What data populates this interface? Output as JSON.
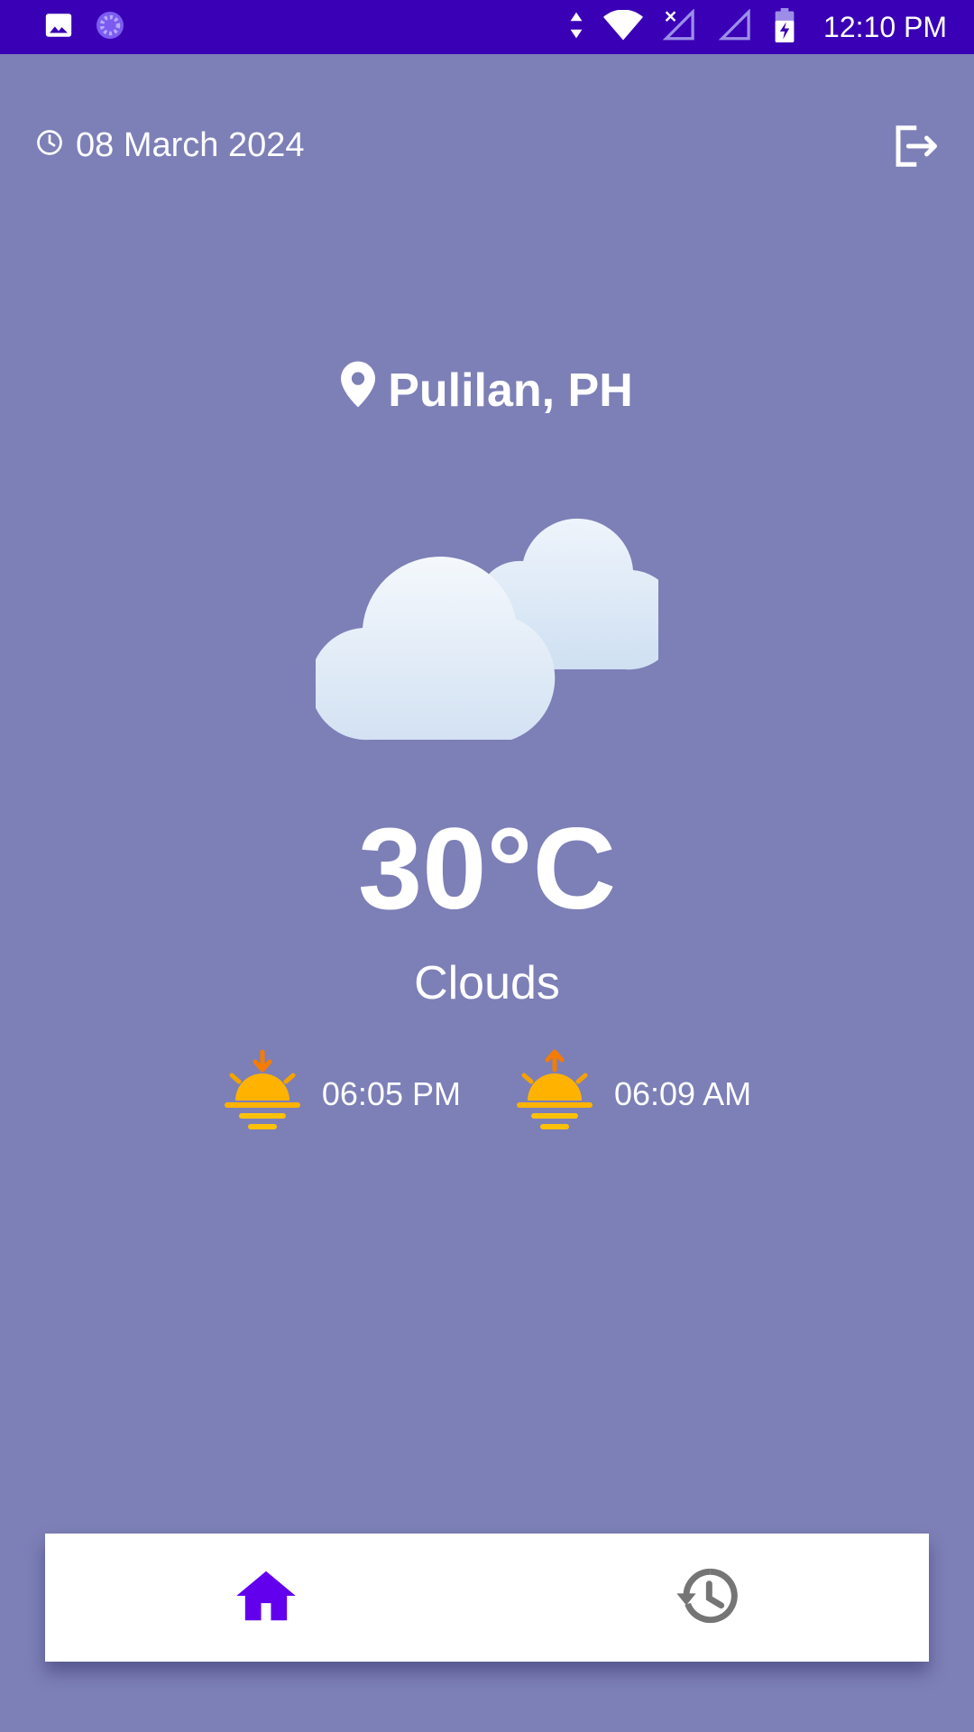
{
  "status_bar": {
    "time": "12:10 PM",
    "icons": [
      "image-icon",
      "sync-icon",
      "data-arrows-icon",
      "wifi-icon",
      "signal-icon",
      "signal-icon",
      "battery-charging-icon"
    ]
  },
  "header": {
    "date": "08 March 2024",
    "date_icon": "clock-icon",
    "logout_icon": "logout-icon"
  },
  "weather": {
    "location": "Pulilan, PH",
    "location_icon": "location-pin-icon",
    "icon": "clouds-icon",
    "temperature": "30°C",
    "condition": "Clouds",
    "sunset_time": "06:05 PM",
    "sunrise_time": "06:09 AM"
  },
  "bottom_nav": {
    "items": [
      {
        "icon": "home-icon",
        "active": true
      },
      {
        "icon": "history-icon",
        "active": false
      }
    ],
    "active_color": "#6200ee",
    "inactive_color": "#757575"
  },
  "colors": {
    "background": "#7d7fb7",
    "status_bar": "#3a00b5",
    "sun_orange": "#ffb300",
    "arrow_orange": "#f57c00"
  }
}
